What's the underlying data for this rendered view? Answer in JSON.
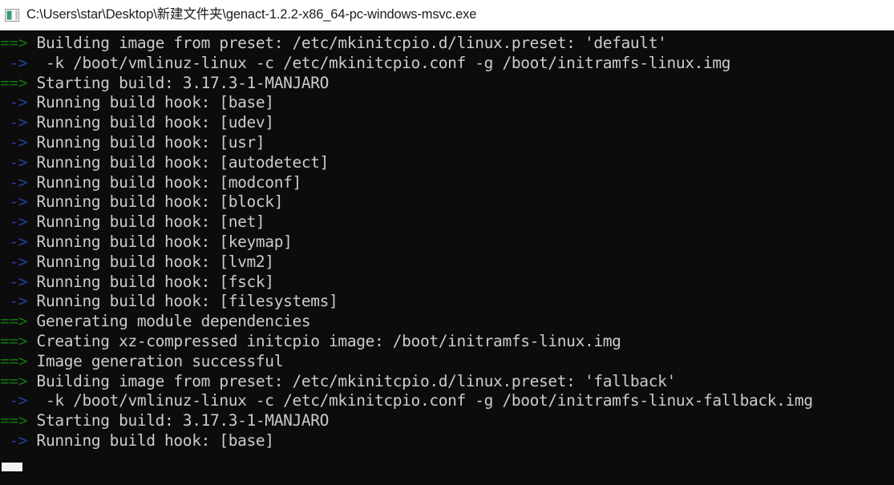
{
  "window": {
    "title": "C:\\Users\\star\\Desktop\\新建文件夹\\genact-1.2.2-x86_64-pc-windows-msvc.exe",
    "icon": "console-window-icon",
    "titlebar_bg": "#ffffff",
    "titlebar_fg": "#1b1b1b"
  },
  "console": {
    "background": "#0c0c0c",
    "foreground": "#cccccc",
    "prefix_green": "#137013",
    "prefix_blue": "#24409c",
    "cursor": "block-cursor",
    "lines": [
      {
        "prefix": "==>",
        "prefix_color": "green",
        "text": " Building image from preset: /etc/mkinitcpio.d/linux.preset: 'default'"
      },
      {
        "prefix": " ->",
        "prefix_color": "blue",
        "text": "  -k /boot/vmlinuz-linux -c /etc/mkinitcpio.conf -g /boot/initramfs-linux.img"
      },
      {
        "prefix": "==>",
        "prefix_color": "green",
        "text": " Starting build: 3.17.3-1-MANJARO"
      },
      {
        "prefix": " ->",
        "prefix_color": "blue",
        "text": " Running build hook: [base]"
      },
      {
        "prefix": " ->",
        "prefix_color": "blue",
        "text": " Running build hook: [udev]"
      },
      {
        "prefix": " ->",
        "prefix_color": "blue",
        "text": " Running build hook: [usr]"
      },
      {
        "prefix": " ->",
        "prefix_color": "blue",
        "text": " Running build hook: [autodetect]"
      },
      {
        "prefix": " ->",
        "prefix_color": "blue",
        "text": " Running build hook: [modconf]"
      },
      {
        "prefix": " ->",
        "prefix_color": "blue",
        "text": " Running build hook: [block]"
      },
      {
        "prefix": " ->",
        "prefix_color": "blue",
        "text": " Running build hook: [net]"
      },
      {
        "prefix": " ->",
        "prefix_color": "blue",
        "text": " Running build hook: [keymap]"
      },
      {
        "prefix": " ->",
        "prefix_color": "blue",
        "text": " Running build hook: [lvm2]"
      },
      {
        "prefix": " ->",
        "prefix_color": "blue",
        "text": " Running build hook: [fsck]"
      },
      {
        "prefix": " ->",
        "prefix_color": "blue",
        "text": " Running build hook: [filesystems]"
      },
      {
        "prefix": "==>",
        "prefix_color": "green",
        "text": " Generating module dependencies"
      },
      {
        "prefix": "==>",
        "prefix_color": "green",
        "text": " Creating xz-compressed initcpio image: /boot/initramfs-linux.img"
      },
      {
        "prefix": "==>",
        "prefix_color": "green",
        "text": " Image generation successful"
      },
      {
        "prefix": "==>",
        "prefix_color": "green",
        "text": " Building image from preset: /etc/mkinitcpio.d/linux.preset: 'fallback'"
      },
      {
        "prefix": " ->",
        "prefix_color": "blue",
        "text": "  -k /boot/vmlinuz-linux -c /etc/mkinitcpio.conf -g /boot/initramfs-linux-fallback.img"
      },
      {
        "prefix": "==>",
        "prefix_color": "green",
        "text": " Starting build: 3.17.3-1-MANJARO"
      },
      {
        "prefix": " ->",
        "prefix_color": "blue",
        "text": " Running build hook: [base]"
      }
    ]
  }
}
